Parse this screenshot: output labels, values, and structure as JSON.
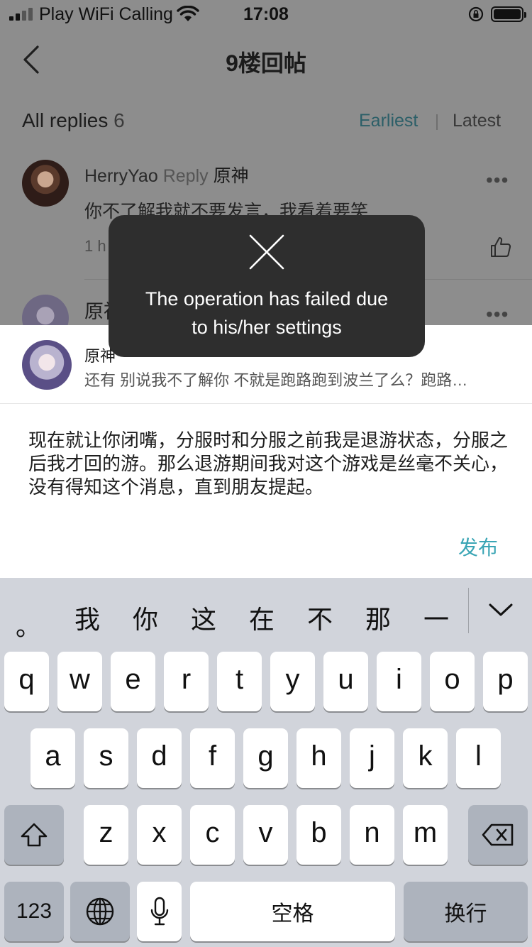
{
  "status_bar": {
    "carrier": "Play WiFi Calling",
    "time": "17:08"
  },
  "header": {
    "title": "9楼回帖"
  },
  "replies": {
    "label": "All replies",
    "count": "6",
    "sort_earliest": "Earliest",
    "sort_latest": "Latest",
    "active_sort_color": "#2c5f68"
  },
  "comments": [
    {
      "user": "HerryYao",
      "reply_word": "Reply",
      "reply_target": "原神",
      "text": "你不了解我就不要发言，我看着要笑",
      "time": "1 h"
    },
    {
      "user": "原神"
    }
  ],
  "toast": {
    "message_line1": "The operation has failed due",
    "message_line2": "to his/her settings",
    "icon": "close-icon"
  },
  "composer": {
    "quote_user": "原神",
    "quote_text": "还有 别说我不了解你 不就是跑路跑到波兰了么？跑路…",
    "text": "现在就让你闭嘴，分服时和分服之前我是退游状态，分服之后我才回的游。那么退游期间我对这个游戏是丝毫不关心，没有得知这个消息，直到朋友提起。",
    "publish_label": "发布",
    "accent_color": "#3aa5b5"
  },
  "keyboard": {
    "candidates": [
      "。",
      "我",
      "你",
      "这",
      "在",
      "不",
      "那",
      "一"
    ],
    "row1": [
      "q",
      "w",
      "e",
      "r",
      "t",
      "y",
      "u",
      "i",
      "o",
      "p"
    ],
    "row2": [
      "a",
      "s",
      "d",
      "f",
      "g",
      "h",
      "j",
      "k",
      "l"
    ],
    "row3": [
      "z",
      "x",
      "c",
      "v",
      "b",
      "n",
      "m"
    ],
    "numbers_label": "123",
    "space_label": "空格",
    "return_label": "换行"
  }
}
